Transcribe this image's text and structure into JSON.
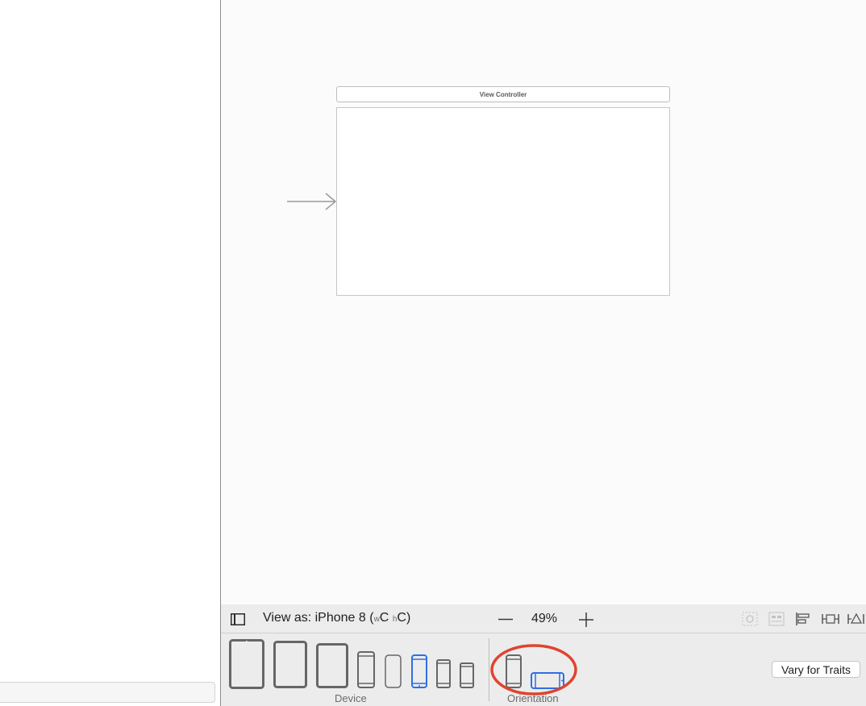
{
  "scene": {
    "title": "View Controller"
  },
  "toolbar": {
    "view_as_prefix": "View as: iPhone 8 (",
    "width_class_small": "w",
    "width_class": "C",
    "height_class_small": "h",
    "height_class": "C",
    "view_as_suffix": ")",
    "zoom": "49%",
    "zoom_out_icon": "minus-icon",
    "zoom_in_icon": "plus-icon"
  },
  "device_bar": {
    "device_label": "Device",
    "orientation_label": "Orientation",
    "vary_button": "Vary for Traits",
    "devices": [
      "ipad-pro-12.9-icon",
      "ipad-pro-10.5-icon",
      "ipad-pro-9.7-icon",
      "iphone-x-icon",
      "iphone-8-plus-icon",
      "iphone-8-icon",
      "iphone-se-icon",
      "iphone-4s-icon"
    ],
    "selected_device": "iPhone 8",
    "selected_orientation": "landscape"
  },
  "colors": {
    "accent": "#2f6fe4",
    "highlight": "#e0432f",
    "icon": "#6f6f6f"
  }
}
